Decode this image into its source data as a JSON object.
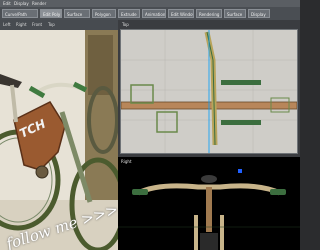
{
  "menubar": {
    "items": [
      "Edit",
      "Display",
      "Render"
    ]
  },
  "toolbar": {
    "tabs": [
      "Curve/Path",
      "Edit Poly",
      "Surface",
      "Polygon",
      "Extrude",
      "Animation",
      "Edit Window",
      "Rendering",
      "Surface",
      "Display"
    ]
  },
  "left_panel": {
    "subbar": [
      "Left",
      "Right",
      "Front",
      "Top"
    ],
    "overlay_text": "follow me >>>"
  },
  "right_panel": {
    "top_viewport_label": "Top",
    "bottom_viewport_label": "Right"
  },
  "colors": {
    "frame": "#9a6a40",
    "wire": "#3c6e3f",
    "viewport_bg": "#cfcdc8",
    "chrome": "#4a4e53"
  }
}
